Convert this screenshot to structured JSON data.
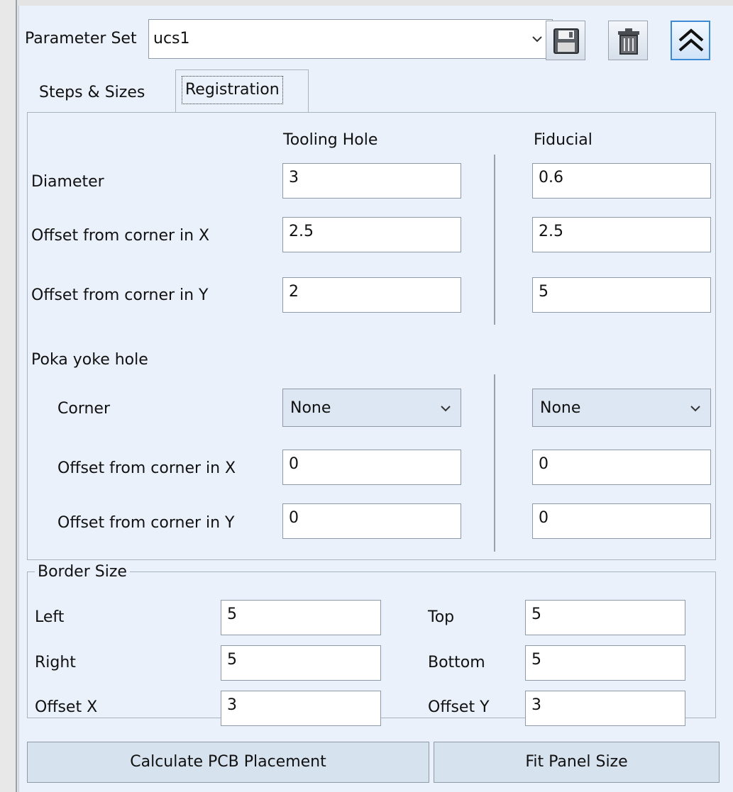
{
  "header": {
    "parameter_set_label": "Parameter Set",
    "parameter_set_value": "ucs1",
    "buttons": {
      "save_icon": "floppy-disk-icon",
      "delete_icon": "trash-icon",
      "collapse_icon": "double-chevron-up-icon"
    }
  },
  "tabs": [
    {
      "label": "Steps & Sizes",
      "selected": false
    },
    {
      "label": "Registration",
      "selected": true
    }
  ],
  "registration": {
    "column_headers": {
      "tooling": "Tooling Hole",
      "fiducial": "Fiducial"
    },
    "rows": {
      "diameter": {
        "label": "Diameter",
        "tooling": "3",
        "fiducial": "0.6"
      },
      "offset_x": {
        "label": "Offset from corner in X",
        "tooling": "2.5",
        "fiducial": "2.5"
      },
      "offset_y": {
        "label": "Offset from corner in Y",
        "tooling": "2",
        "fiducial": "5"
      }
    },
    "poka_yoke": {
      "title": "Poka yoke hole",
      "corner": {
        "label": "Corner",
        "tooling": "None",
        "fiducial": "None"
      },
      "offset_x": {
        "label": "Offset from corner in X",
        "tooling": "0",
        "fiducial": "0"
      },
      "offset_y": {
        "label": "Offset from corner in Y",
        "tooling": "0",
        "fiducial": "0"
      }
    }
  },
  "border_size": {
    "title": "Border Size",
    "left": {
      "label": "Left",
      "value": "5"
    },
    "top": {
      "label": "Top",
      "value": "5"
    },
    "right": {
      "label": "Right",
      "value": "5"
    },
    "bottom": {
      "label": "Bottom",
      "value": "5"
    },
    "offset_x": {
      "label": "Offset X",
      "value": "3"
    },
    "offset_y": {
      "label": "Offset Y",
      "value": "3"
    }
  },
  "actions": {
    "calculate": "Calculate PCB Placement",
    "fit": "Fit Panel Size"
  },
  "colors": {
    "panel_bg": "#eaf1fb",
    "field_bg": "#ffffff",
    "combo_bg": "#dde7f3",
    "button_bg": "#d7e2ef",
    "border": "#8e9aa8",
    "highlight": "#3c8ad6"
  }
}
